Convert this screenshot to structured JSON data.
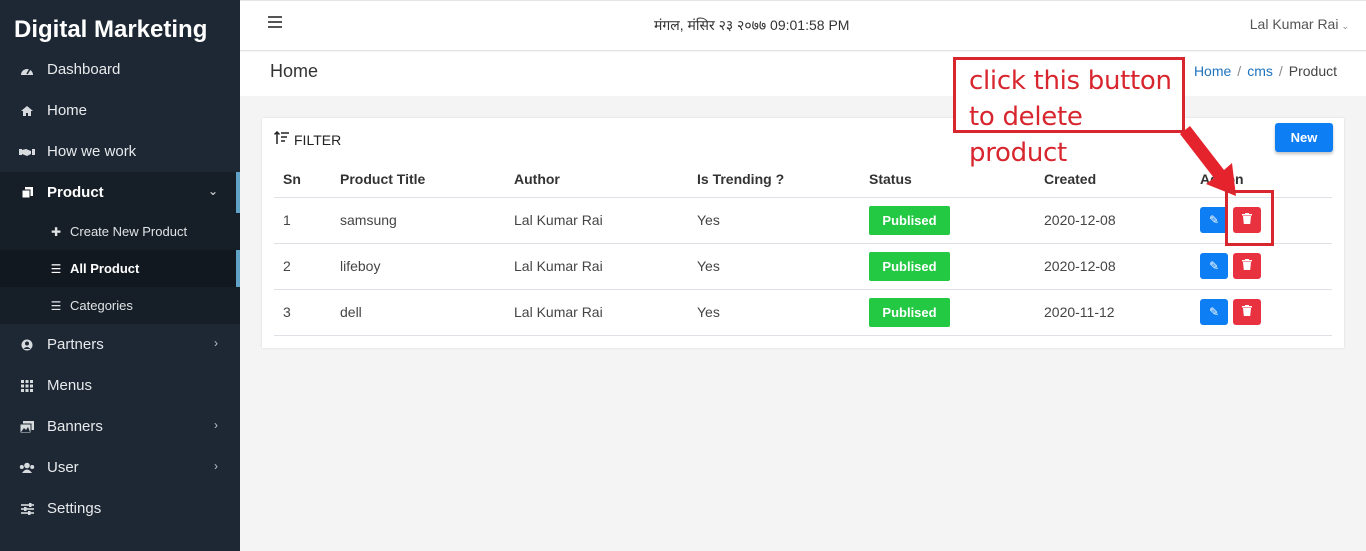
{
  "brand": "Digital Marketing",
  "sidebar": {
    "items": [
      {
        "label": "Dashboard",
        "icon": "dashboard-icon"
      },
      {
        "label": "Home",
        "icon": "home-icon"
      },
      {
        "label": "How we work",
        "icon": "handshake-icon"
      },
      {
        "label": "Product",
        "icon": "copy-icon",
        "active": true
      },
      {
        "label": "Partners",
        "icon": "user-circle-icon"
      },
      {
        "label": "Menus",
        "icon": "grid-icon"
      },
      {
        "label": "Banners",
        "icon": "images-icon"
      },
      {
        "label": "User",
        "icon": "users-icon"
      },
      {
        "label": "Settings",
        "icon": "sliders-icon"
      }
    ],
    "sub_items": [
      {
        "label": "Create New Product",
        "icon": "plus-icon"
      },
      {
        "label": "All Product",
        "icon": "list-icon",
        "current": true
      },
      {
        "label": "Categories",
        "icon": "list-icon"
      }
    ]
  },
  "topbar": {
    "datetime": "मंगल, मंसिर २३ २०७७ 09:01:58 PM",
    "user": "Lal Kumar Rai"
  },
  "page": {
    "title": "Home",
    "breadcrumb": [
      "Home",
      "cms",
      "Product"
    ]
  },
  "card": {
    "filter_label": "FILTER",
    "new_label": "New",
    "columns": [
      "Sn",
      "Product Title",
      "Author",
      "Is Trending ?",
      "Status",
      "Created",
      "Action"
    ],
    "rows": [
      {
        "sn": "1",
        "title": "samsung",
        "author": "Lal Kumar Rai",
        "trending": "Yes",
        "status": "Publised",
        "created": "2020-12-08"
      },
      {
        "sn": "2",
        "title": "lifeboy",
        "author": "Lal Kumar Rai",
        "trending": "Yes",
        "status": "Publised",
        "created": "2020-12-08"
      },
      {
        "sn": "3",
        "title": "dell",
        "author": "Lal Kumar Rai",
        "trending": "Yes",
        "status": "Publised",
        "created": "2020-11-12"
      }
    ]
  },
  "annotation": {
    "line1": "click this button",
    "line2": "to delete product"
  },
  "colors": {
    "sidebar_bg": "#1d2834",
    "accent_blue": "#0d7ef4",
    "status_green": "#23c843",
    "delete_red": "#e8323f",
    "annotation_red": "#d8262f"
  }
}
